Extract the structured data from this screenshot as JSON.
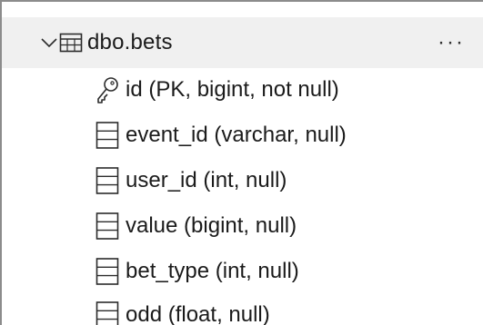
{
  "table": {
    "name": "dbo.bets",
    "more_label": "···"
  },
  "columns": [
    {
      "label": "id (PK, bigint, not null)",
      "icon": "key-icon"
    },
    {
      "label": "event_id (varchar, null)",
      "icon": "column-icon"
    },
    {
      "label": "user_id (int, null)",
      "icon": "column-icon"
    },
    {
      "label": "value (bigint, null)",
      "icon": "column-icon"
    },
    {
      "label": "bet_type (int, null)",
      "icon": "column-icon"
    },
    {
      "label": "odd (float, null)",
      "icon": "column-icon"
    }
  ],
  "colors": {
    "header_bg": "#f0f0f0",
    "text": "#1b1b1b",
    "border": "#8c8c8c"
  }
}
